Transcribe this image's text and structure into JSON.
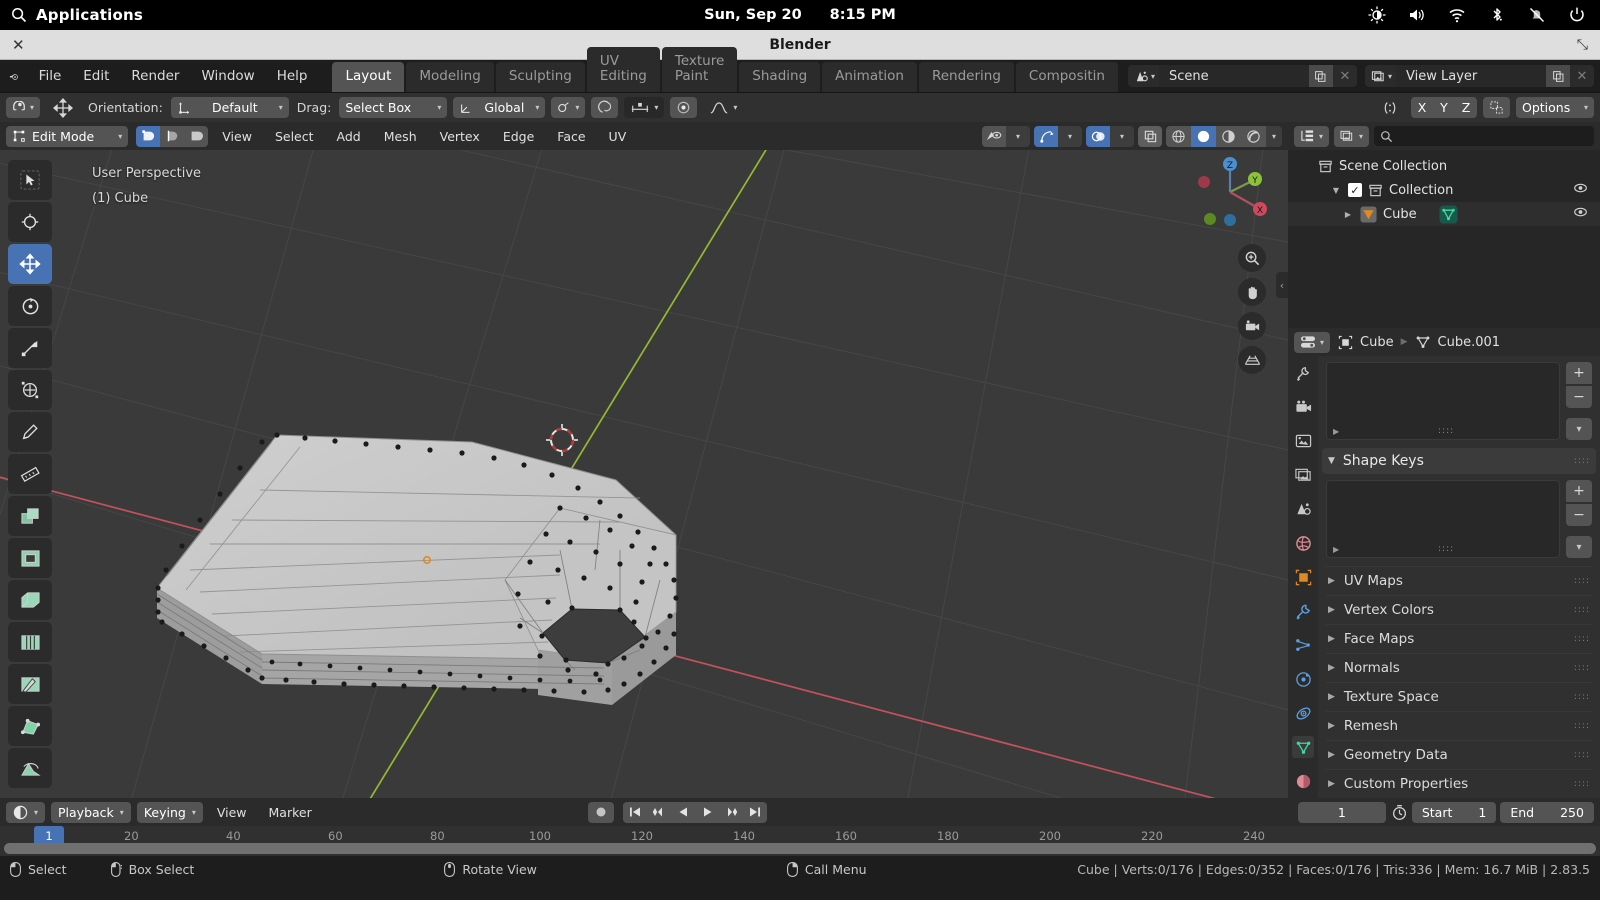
{
  "os": {
    "applications_label": "Applications",
    "date": "Sun, Sep 20",
    "time": "8:15 PM",
    "tray": [
      "brightness-icon",
      "volume-icon",
      "wifi-icon",
      "bluetooth-icon",
      "notifications-muted-icon",
      "power-icon"
    ]
  },
  "window": {
    "title": "Blender",
    "close_label": "✕",
    "maximize_label": "⤡"
  },
  "topbar": {
    "menus": [
      "File",
      "Edit",
      "Render",
      "Window",
      "Help"
    ],
    "workspaces": [
      "Layout",
      "Modeling",
      "Sculpting",
      "UV Editing",
      "Texture Paint",
      "Shading",
      "Animation",
      "Rendering",
      "Compositin"
    ],
    "active_workspace": "Layout",
    "scene_name": "Scene",
    "view_layer_name": "View Layer"
  },
  "tool_settings": {
    "orientation_label": "Orientation:",
    "orientation_value": "Default",
    "drag_label": "Drag:",
    "drag_value": "Select Box",
    "transform_value": "Global",
    "axis_x": "X",
    "axis_y": "Y",
    "axis_z": "Z",
    "options_label": "Options"
  },
  "viewport": {
    "mode": "Edit Mode",
    "menus": [
      "View",
      "Select",
      "Add",
      "Mesh",
      "Vertex",
      "Edge",
      "Face",
      "UV"
    ],
    "overlay_line1": "User Perspective",
    "overlay_line2": "(1) Cube",
    "select_modes": [
      "vertex-select",
      "edge-select",
      "face-select"
    ],
    "active_select_mode": "vertex-select",
    "gizmo_axes": {
      "x": "X",
      "y": "Y",
      "z": "Z"
    },
    "tools": [
      "tweak-tool",
      "cursor-tool",
      "move-tool",
      "rotate-tool",
      "scale-tool",
      "transform-tool",
      "annotate-tool",
      "measure-tool",
      "extrude-region-tool",
      "inset-faces-tool",
      "bevel-tool",
      "loop-cut-tool",
      "knife-tool",
      "poly-build-tool",
      "spin-tool"
    ],
    "active_tool": "move-tool",
    "colors": {
      "background": "#3a3a3a",
      "grid": "#4a4a4a",
      "axis_x_red": "#cd5360",
      "axis_y_green": "#9ac130",
      "mesh_light": "#c9c9c9",
      "mesh_mid": "#a8a8a8",
      "mesh_dark": "#3a3a3a",
      "accent_blue": "#4772b3"
    }
  },
  "outliner": {
    "search_placeholder": "",
    "rows": [
      {
        "label": "Scene Collection",
        "icon": "collection-icon",
        "depth": 0,
        "has_eye": false,
        "has_check": false
      },
      {
        "label": "Collection",
        "icon": "collection-icon",
        "depth": 1,
        "has_eye": true,
        "has_check": true
      },
      {
        "label": "Cube",
        "icon": "mesh-object-icon",
        "depth": 2,
        "has_eye": true,
        "has_check": false,
        "data_icon": "mesh-data-icon"
      }
    ]
  },
  "properties": {
    "breadcrumb_object": "Cube",
    "breadcrumb_data": "Cube.001",
    "panels_open": [
      "Shape Keys"
    ],
    "shape_keys_label": "Shape Keys",
    "collapsed_panels": [
      "UV Maps",
      "Vertex Colors",
      "Face Maps",
      "Normals",
      "Texture Space",
      "Remesh",
      "Geometry Data",
      "Custom Properties"
    ],
    "tabs": [
      "tool-tab",
      "render-tab",
      "output-tab",
      "view-layer-tab",
      "scene-tab",
      "world-tab",
      "object-tab",
      "modifier-tab",
      "particles-tab",
      "physics-tab",
      "constraints-tab",
      "object-data-tab",
      "material-tab"
    ],
    "active_tab": "object-data-tab",
    "add_label": "+",
    "remove_label": "−"
  },
  "timeline": {
    "editor_label": "",
    "playback_label": "Playback",
    "keying_label": "Keying",
    "view_label": "View",
    "marker_label": "Marker",
    "current_frame": "1",
    "start_label": "Start",
    "start_value": "1",
    "end_label": "End",
    "end_value": "250",
    "ticks": [
      "20",
      "40",
      "60",
      "80",
      "100",
      "120",
      "140",
      "160",
      "180",
      "200",
      "220",
      "240"
    ],
    "playhead_label": "1"
  },
  "statusbar": {
    "hints": [
      {
        "icon": "mouse-left-icon",
        "label": "Select"
      },
      {
        "icon": "mouse-left-drag-icon",
        "label": "Box Select"
      },
      {
        "icon": "mouse-middle-icon",
        "label": "Rotate View"
      },
      {
        "icon": "mouse-right-icon",
        "label": "Call Menu"
      }
    ],
    "stats": "Cube | Verts:0/176 | Edges:0/352 | Faces:0/176 | Tris:336 | Mem: 16.7 MiB | 2.83.5"
  }
}
